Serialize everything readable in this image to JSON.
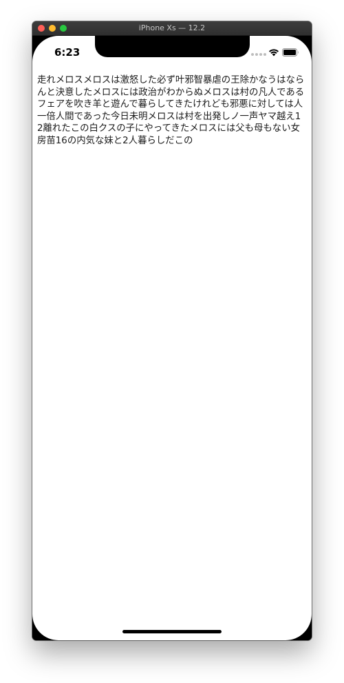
{
  "window": {
    "title": "iPhone Xs — 12.2"
  },
  "status_bar": {
    "time": "6:23",
    "icons": [
      "cellular-signal-icon",
      "wifi-icon",
      "battery-icon"
    ]
  },
  "content": {
    "text": "走れメロスメロスは激怒した必ず叶邪智暴虐の王除かなうはならんと決意したメロスには政治がわからぬメロスは村の凡人であるフェアを吹き羊と遊んで暮らしてきたけれども邪悪に対しては人一倍人間であった今日未明メロスは村を出発しノ一声ヤマ越え12離れたこの白クスの子にやってきたメロスには父も母もない女房苗16の内気な妹と2人暮らしだこの"
  },
  "colors": {
    "traffic_close": "#fe5f57",
    "traffic_minimize": "#febb2e",
    "traffic_zoom": "#28c840",
    "screen_background": "#ffffff",
    "text": "#1a1a1a"
  }
}
